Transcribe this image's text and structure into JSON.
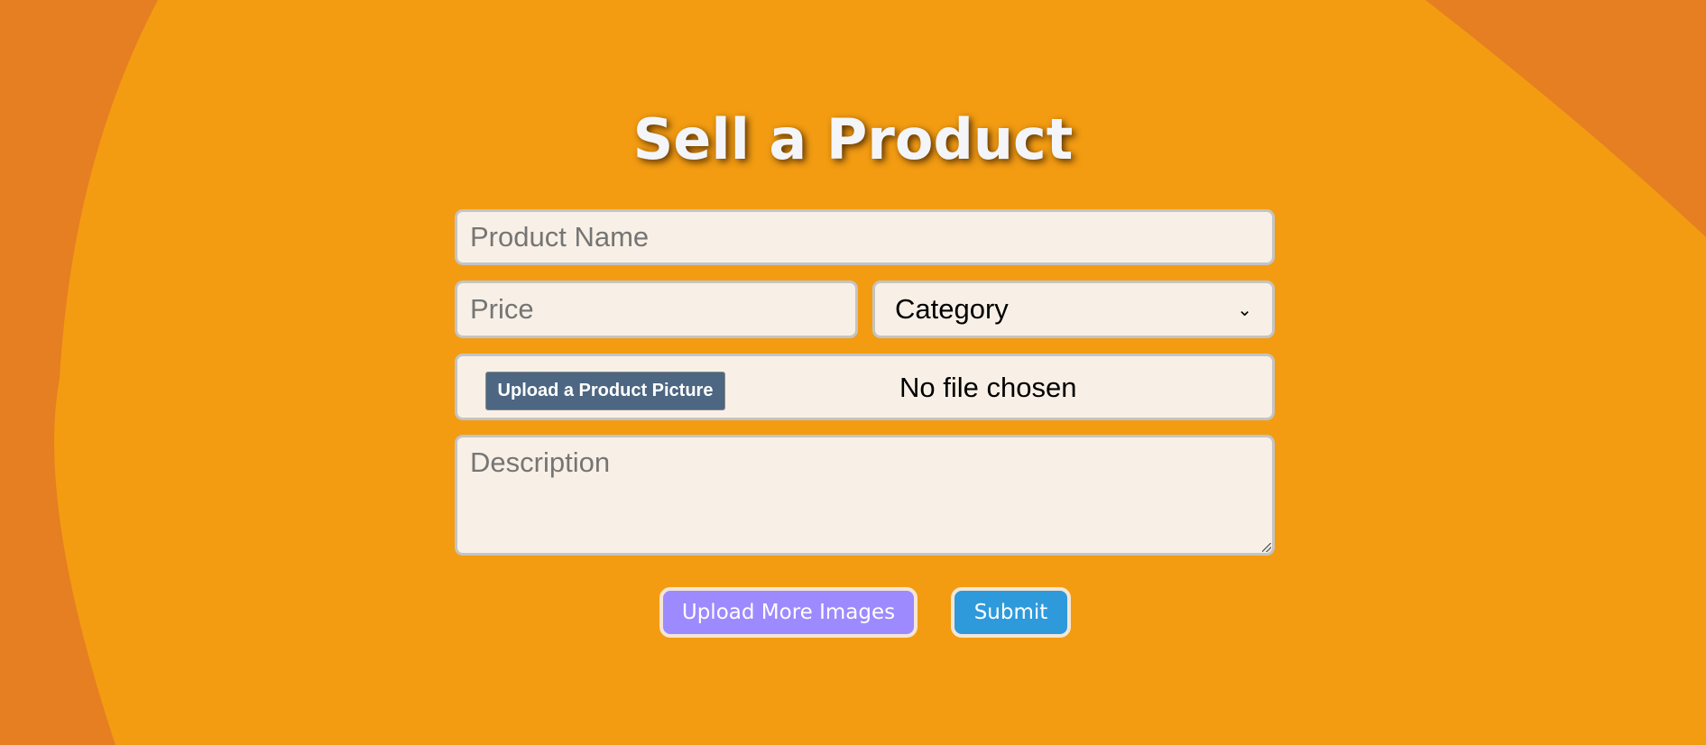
{
  "colors": {
    "background_main": "#F39C12",
    "background_edge": "#E67E22",
    "input_bg": "#F8F0E6",
    "file_button": "#4D6682",
    "upload_more_button": "#9D8AFF",
    "submit_button": "#2E9ADB"
  },
  "title": "Sell a Product",
  "form": {
    "product_name_placeholder": "Product Name",
    "price_placeholder": "Price",
    "category_selected": "Category",
    "file_button_label": "Upload a Product Picture",
    "file_status": "No file chosen",
    "description_placeholder": "Description"
  },
  "actions": {
    "upload_more_label": "Upload More Images",
    "submit_label": "Submit"
  },
  "icons": {
    "select_arrow": "chevron-down-icon",
    "resize": "resize-grip-icon"
  }
}
